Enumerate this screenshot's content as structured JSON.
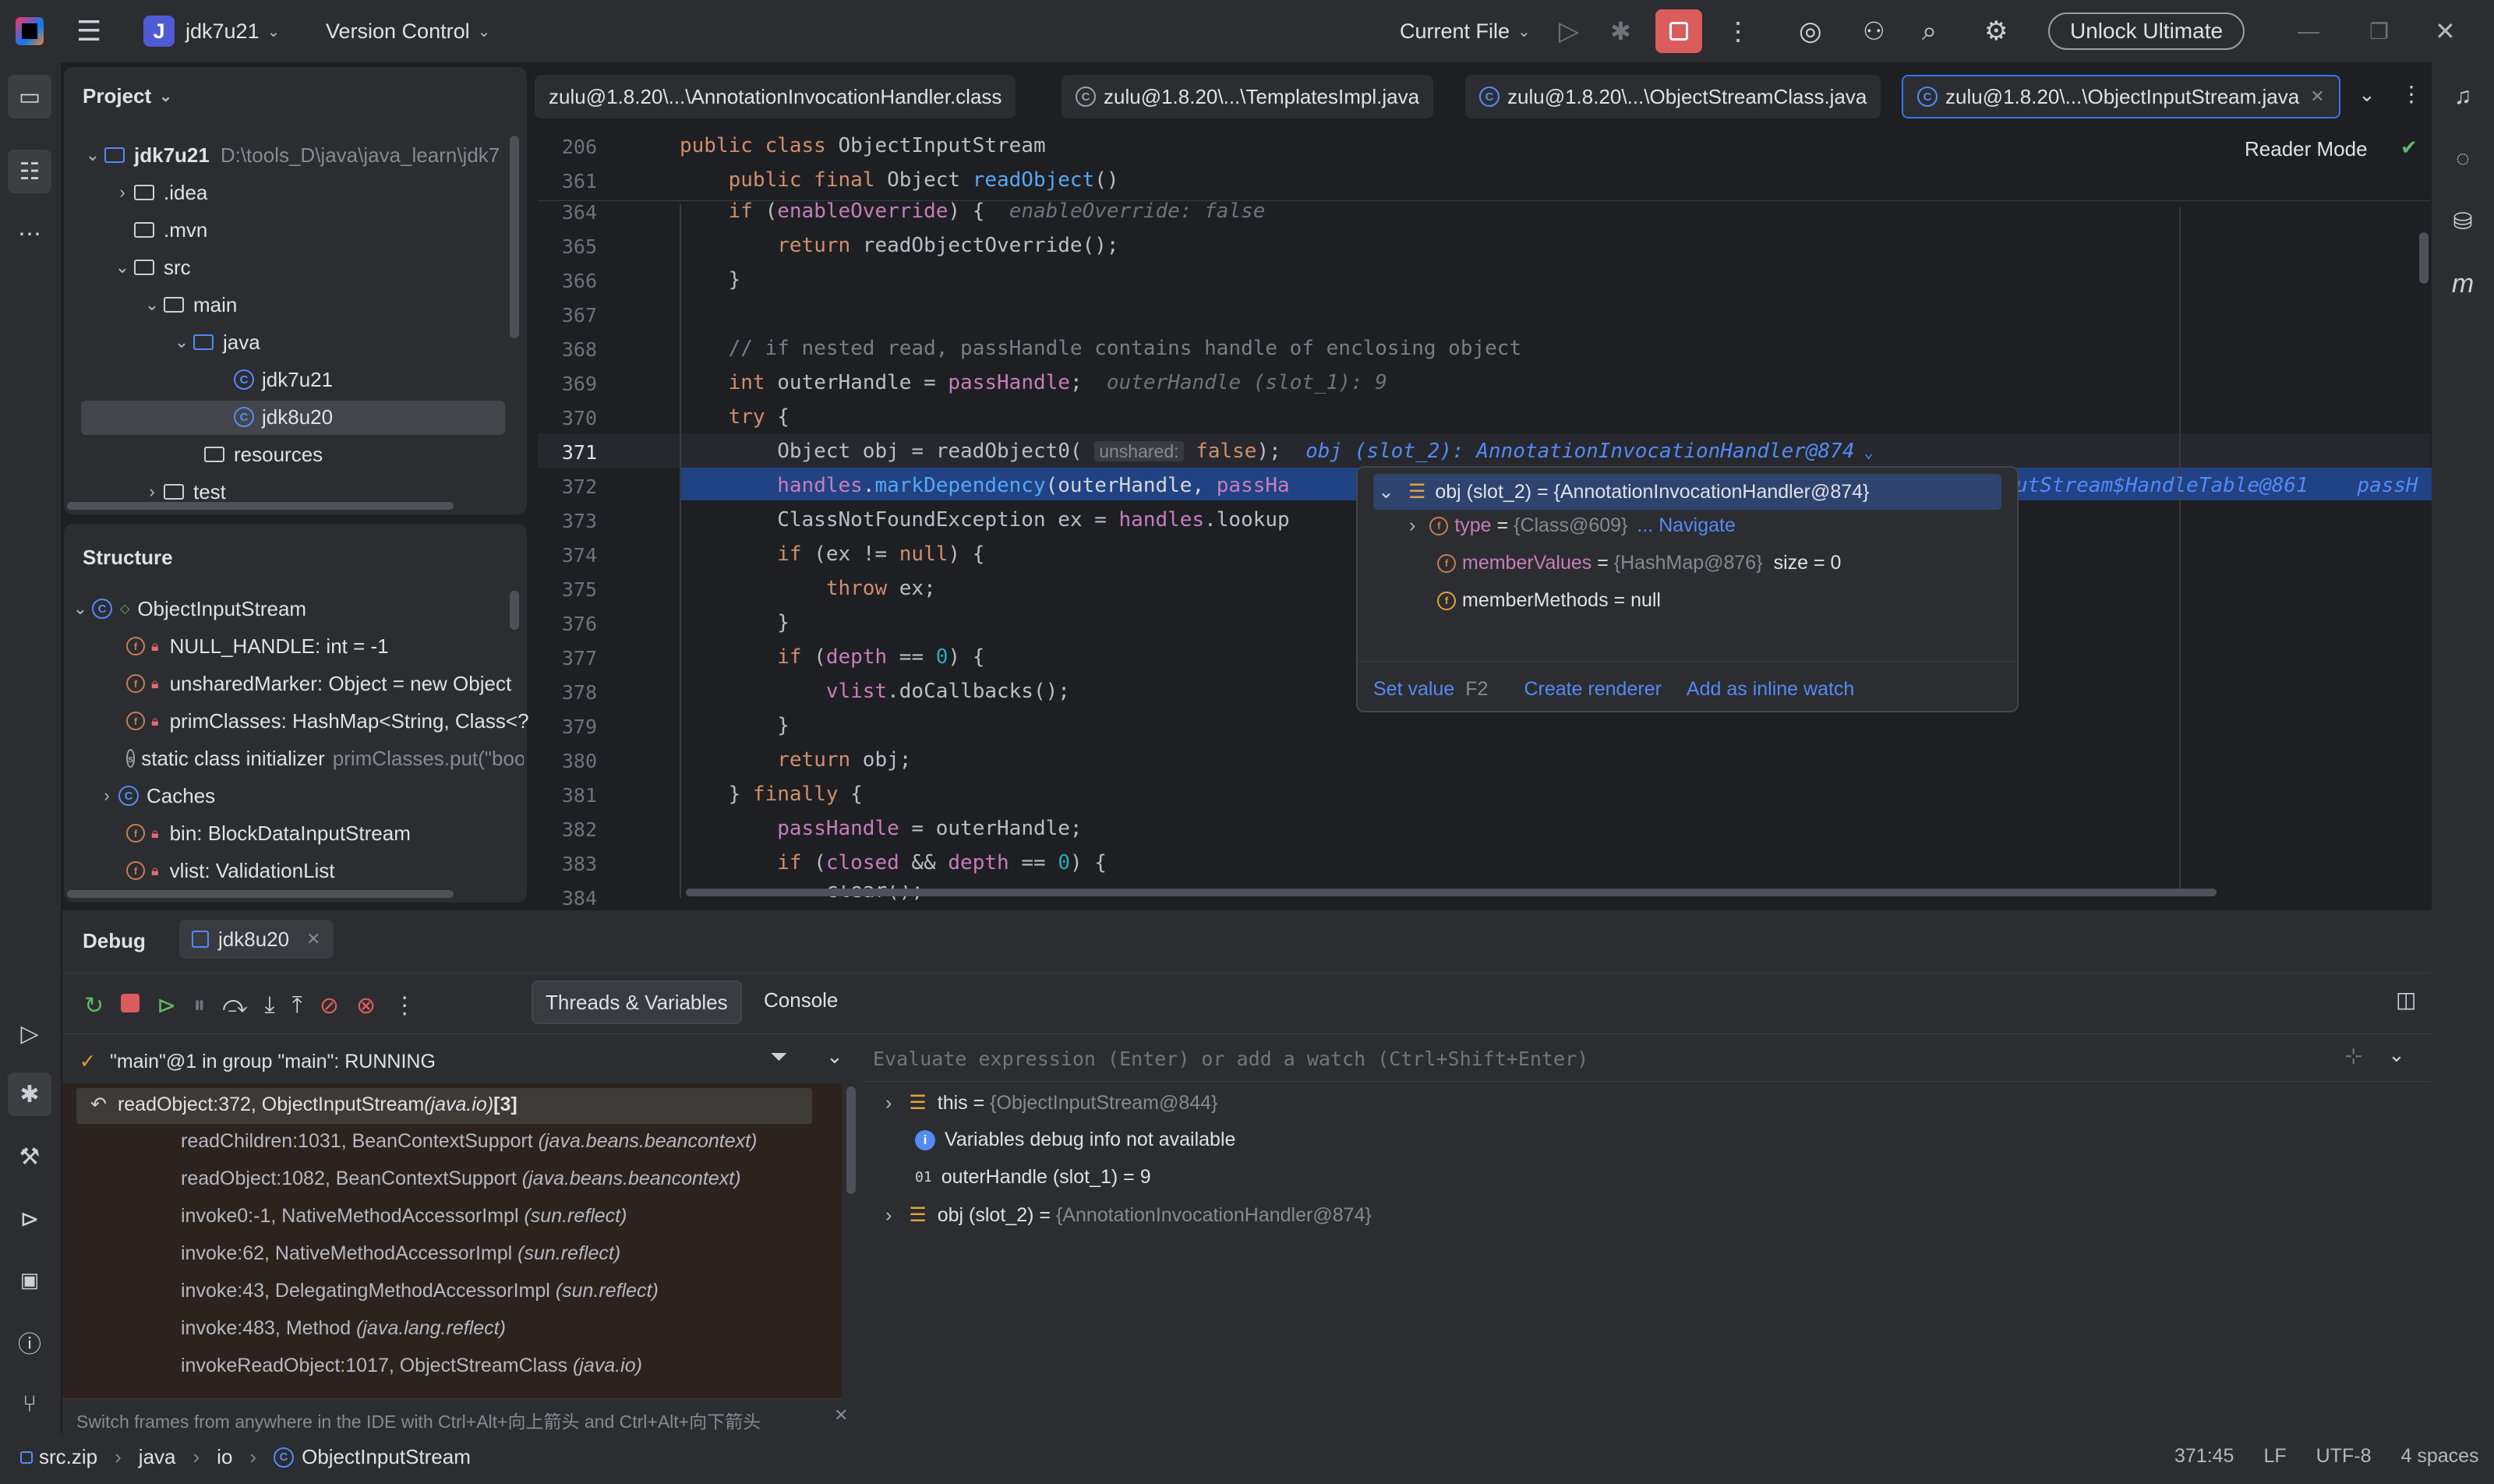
{
  "titlebar": {
    "project_badge": "J",
    "project_name": "jdk7u21",
    "vcs": "Version Control",
    "run_config": "Current File",
    "unlock": "Unlock Ultimate"
  },
  "project_panel": {
    "title": "Project",
    "root_name": "jdk7u21",
    "root_path": "D:\\tools_D\\java\\java_learn\\jdk7u21",
    "items": [
      ".idea",
      ".mvn",
      "src",
      "main",
      "java",
      "jdk7u21",
      "jdk8u20",
      "resources",
      "test"
    ]
  },
  "structure_panel": {
    "title": "Structure",
    "class_name": "ObjectInputStream",
    "members": [
      "NULL_HANDLE: int = -1",
      "unsharedMarker: Object = new Object",
      "primClasses: HashMap<String, Class<?",
      "static class initializer",
      "Caches",
      "bin: BlockDataInputStream",
      "vlist: ValidationList"
    ],
    "initializer_hint": "primClasses.put(\"boo"
  },
  "editor": {
    "tabs": [
      "zulu@1.8.20\\...\\AnnotationInvocationHandler.class",
      "zulu@1.8.20\\...\\TemplatesImpl.java",
      "zulu@1.8.20\\...\\ObjectStreamClass.java",
      "zulu@1.8.20\\...\\ObjectInputStream.java"
    ],
    "reader_mode": "Reader Mode",
    "sticky": [
      {
        "num": "206",
        "a": "public class ",
        "b": "ObjectInputStream"
      },
      {
        "num": "361",
        "a": "    public final ",
        "b": "Object ",
        "c": "readObject",
        "d": "()"
      }
    ],
    "line_numbers": [
      "364",
      "365",
      "366",
      "367",
      "368",
      "369",
      "370",
      "371",
      "372",
      "373",
      "374",
      "375",
      "376",
      "377",
      "378",
      "379",
      "380",
      "381",
      "382",
      "383",
      "384"
    ],
    "hint_enable_override": "enableOverride: false",
    "hint_outer_handle": "outerHandle (slot_1): 9",
    "inline_unshared": "unshared:",
    "inline_obj": "obj (slot_2): AnnotationInvocationHandler@874",
    "inline_handles": "utStream$HandleTable@861",
    "inline_pass": "passH"
  },
  "popup": {
    "root": "obj (slot_2) = {AnnotationInvocationHandler@874}",
    "type_name": "type",
    "type_value": "{Class@609}",
    "type_link": "... Navigate",
    "member_values_name": "memberValues",
    "member_values_value": "{HashMap@876}",
    "member_values_size": "size = 0",
    "member_methods": "memberMethods = null",
    "set_value": "Set value",
    "set_value_key": "F2",
    "create_renderer": "Create renderer",
    "add_inline_watch": "Add as inline watch"
  },
  "debug": {
    "title": "Debug",
    "session": "jdk8u20",
    "tab_threads": "Threads & Variables",
    "tab_console": "Console",
    "thread": "\"main\"@1 in group \"main\": RUNNING",
    "evaluate_placeholder": "Evaluate expression (Enter) or add a watch (Ctrl+Shift+Enter)",
    "frames": [
      {
        "m": "readObject:372, ObjectInputStream ",
        "p": "(java.io)",
        "x": " [3]"
      },
      {
        "m": "readChildren:1031, BeanContextSupport ",
        "p": "(java.beans.beancontext)",
        "x": ""
      },
      {
        "m": "readObject:1082, BeanContextSupport ",
        "p": "(java.beans.beancontext)",
        "x": ""
      },
      {
        "m": "invoke0:-1, NativeMethodAccessorImpl ",
        "p": "(sun.reflect)",
        "x": ""
      },
      {
        "m": "invoke:62, NativeMethodAccessorImpl ",
        "p": "(sun.reflect)",
        "x": ""
      },
      {
        "m": "invoke:43, DelegatingMethodAccessorImpl ",
        "p": "(sun.reflect)",
        "x": ""
      },
      {
        "m": "invoke:483, Method ",
        "p": "(java.lang.reflect)",
        "x": ""
      },
      {
        "m": "invokeReadObject:1017, ObjectStreamClass ",
        "p": "(java.io)",
        "x": ""
      }
    ],
    "frames_hint": "Switch frames from anywhere in the IDE with Ctrl+Alt+向上箭头 and Ctrl+Alt+向下箭头",
    "vars": {
      "this_name": "this",
      "this_value": "{ObjectInputStream@844}",
      "info": "Variables debug info not available",
      "outer": "outerHandle (slot_1) = 9",
      "obj_name": "obj (slot_2)",
      "obj_value": "{AnnotationInvocationHandler@874}"
    }
  },
  "statusbar": {
    "crumbs": [
      "src.zip",
      "java",
      "io",
      "ObjectInputStream"
    ],
    "position": "371:45",
    "line_sep": "LF",
    "encoding": "UTF-8",
    "indent": "4 spaces"
  }
}
